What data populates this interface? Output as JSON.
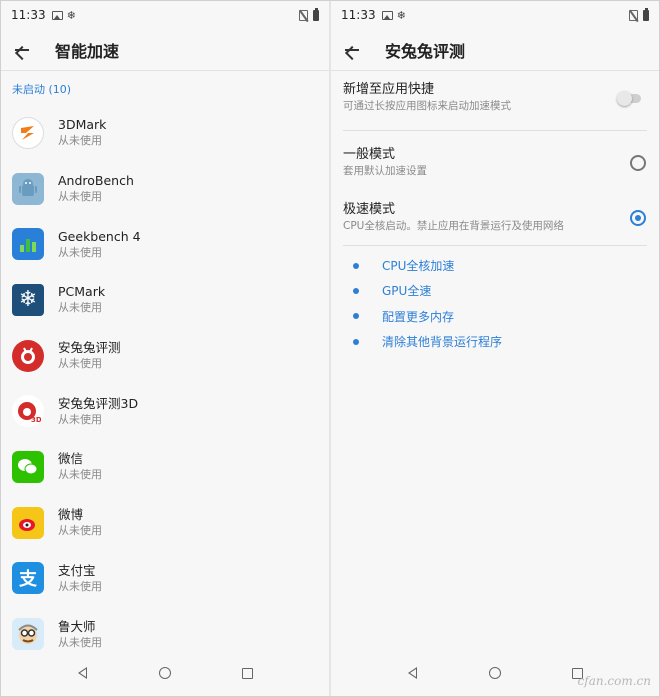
{
  "left": {
    "status_time": "11:33",
    "title": "智能加速",
    "section_header": "未启动 (10)",
    "apps": [
      {
        "name": "3DMark",
        "status": "从未使用",
        "icon": "3dmark-icon",
        "color": "#f07d1a"
      },
      {
        "name": "AndroBench",
        "status": "从未使用",
        "icon": "androbench-icon",
        "color": "#6fa5c9"
      },
      {
        "name": "Geekbench 4",
        "status": "从未使用",
        "icon": "geekbench-icon",
        "color": "#2a7fd8"
      },
      {
        "name": "PCMark",
        "status": "从未使用",
        "icon": "pcmark-icon",
        "color": "#1e4f7a"
      },
      {
        "name": "安兔兔评测",
        "status": "从未使用",
        "icon": "antutu-icon",
        "color": "#d42b2b"
      },
      {
        "name": "安兔兔评测3D",
        "status": "从未使用",
        "icon": "antutu-3d-icon",
        "color": "#d42b2b"
      },
      {
        "name": "微信",
        "status": "从未使用",
        "icon": "wechat-icon",
        "color": "#2dc100"
      },
      {
        "name": "微博",
        "status": "从未使用",
        "icon": "weibo-icon",
        "color": "#f5c518"
      },
      {
        "name": "支付宝",
        "status": "从未使用",
        "icon": "alipay-icon",
        "color": "#1e8fe1"
      },
      {
        "name": "鲁大师",
        "status": "从未使用",
        "icon": "ludashi-icon",
        "color": "#4aa3df"
      }
    ]
  },
  "right": {
    "status_time": "11:33",
    "title": "安兔兔评测",
    "shortcut": {
      "title": "新增至应用快捷",
      "subtitle": "可通过长按应用图标来启动加速模式",
      "enabled": false
    },
    "normal_mode": {
      "title": "一般模式",
      "subtitle": "套用默认加速设置",
      "selected": false
    },
    "fast_mode": {
      "title": "极速模式",
      "subtitle": "CPU全核启动。禁止应用在背景运行及使用网络",
      "selected": true
    },
    "features": [
      "CPU全核加速",
      "GPU全速",
      "配置更多内存",
      "清除其他背景运行程序"
    ]
  },
  "watermark": "cfan.com.cn",
  "accent_color": "#2d7fd6"
}
